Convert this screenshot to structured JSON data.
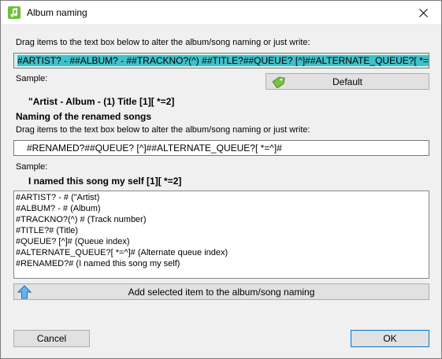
{
  "window": {
    "title": "Album naming",
    "icon": "music-note-icon",
    "close_icon": "close-icon"
  },
  "album_section": {
    "instruction": "Drag items to the text box below to alter the album/song naming or just write:",
    "input_value": "#ARTIST? - ##ALBUM? - ##TRACKNO?(^) ##TITLE?##QUEUE? [^]##ALTERNATE_QUEUE?[ *=^]#",
    "sample_label": "Sample:",
    "sample_value": "\"Artist - Album - (1) Title [1][ *=2]",
    "default_button": "Default",
    "default_icon": "tag-icon"
  },
  "renamed_section": {
    "heading": "Naming of the renamed songs",
    "instruction": "Drag items to the text box below to alter the album/song naming or just write:",
    "input_value": "#RENAMED?##QUEUE? [^]##ALTERNATE_QUEUE?[ *=^]#",
    "sample_label": "Sample:",
    "sample_value": "I named this song my self [1][ *=2]"
  },
  "items_list": [
    "#ARTIST? - # (\"Artist)",
    "#ALBUM? - # (Album)",
    "#TRACKNO?(^) # (Track number)",
    "#TITLE?# (Title)",
    "#QUEUE? [^]# (Queue index)",
    "#ALTERNATE_QUEUE?[ *=^]# (Alternate queue index)",
    "#RENAMED?# (I named this song my self)"
  ],
  "add_button": {
    "label": "Add selected item to the album/song naming",
    "icon": "arrow-up-icon"
  },
  "footer": {
    "cancel": "Cancel",
    "ok": "OK"
  },
  "colors": {
    "selection": "#3fc1c9",
    "focus_border": "#0078d7",
    "icon_green": "#6cbf3a"
  }
}
